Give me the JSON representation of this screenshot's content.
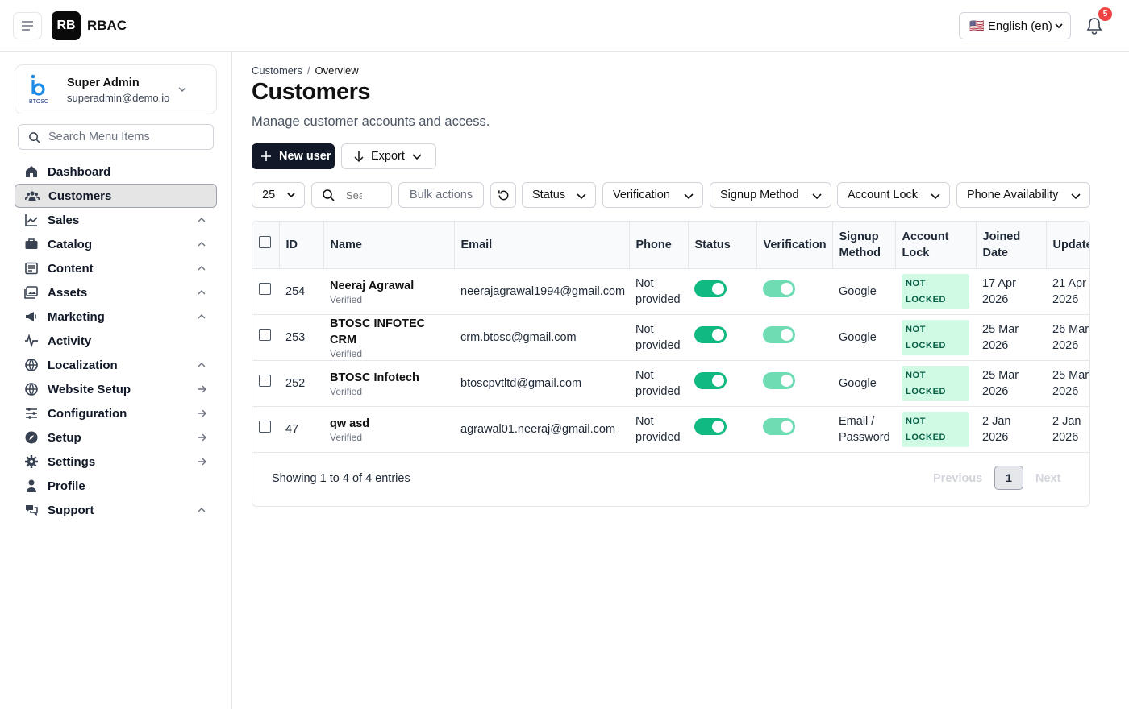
{
  "app": {
    "logo_text": "RB",
    "title": "RBAC"
  },
  "header": {
    "language": "🇺🇸 English (en)",
    "notification_count": "5"
  },
  "user": {
    "name": "Super Admin",
    "email": "superadmin@demo.io",
    "logo_text": "BTOSC"
  },
  "sidebar": {
    "search_placeholder": "Search Menu Items",
    "items": [
      {
        "label": "Dashboard",
        "icon": "home-icon",
        "trail": ""
      },
      {
        "label": "Customers",
        "icon": "users-icon",
        "trail": "",
        "active": true
      },
      {
        "label": "Sales",
        "icon": "chart-line-icon",
        "trail": "up"
      },
      {
        "label": "Catalog",
        "icon": "briefcase-icon",
        "trail": "up"
      },
      {
        "label": "Content",
        "icon": "newspaper-icon",
        "trail": "up"
      },
      {
        "label": "Assets",
        "icon": "images-icon",
        "trail": "up"
      },
      {
        "label": "Marketing",
        "icon": "megaphone-icon",
        "trail": "up"
      },
      {
        "label": "Activity",
        "icon": "activity-icon",
        "trail": ""
      },
      {
        "label": "Localization",
        "icon": "globe-icon",
        "trail": "up"
      },
      {
        "label": "Website Setup",
        "icon": "globe-icon",
        "trail": "arrow"
      },
      {
        "label": "Configuration",
        "icon": "sliders-icon",
        "trail": "arrow"
      },
      {
        "label": "Setup",
        "icon": "compass-icon",
        "trail": "arrow"
      },
      {
        "label": "Settings",
        "icon": "gear-icon",
        "trail": "arrow"
      },
      {
        "label": "Profile",
        "icon": "person-icon",
        "trail": ""
      },
      {
        "label": "Support",
        "icon": "chat-icon",
        "trail": "up"
      }
    ]
  },
  "page": {
    "breadcrumb": [
      "Customers",
      "Overview"
    ],
    "title": "Customers",
    "subtitle": "Manage customer accounts and access.",
    "new_user_label": "New user",
    "export_label": "Export"
  },
  "toolbar": {
    "per_page": "25",
    "search_placeholder": "Search",
    "bulk_actions": "Bulk actions",
    "filters": [
      "Status",
      "Verification",
      "Signup Method",
      "Account Lock",
      "Phone Availability"
    ]
  },
  "table": {
    "headers": [
      "ID",
      "Name",
      "Email",
      "Phone",
      "Status",
      "Verification",
      "Signup Method",
      "Account Lock",
      "Joined Date",
      "Updated"
    ],
    "rows": [
      {
        "id": "254",
        "name": "Neeraj Agrawal",
        "verified": "Verified",
        "email": "neerajagrawal1994@gmail.com",
        "phone": "Not provided",
        "status": true,
        "verification": true,
        "signup": "Google",
        "lock": "NOT LOCKED",
        "joined": "17 Apr 2026",
        "updated": "21 Apr 2026"
      },
      {
        "id": "253",
        "name": "BTOSC INFOTEC CRM",
        "verified": "Verified",
        "email": "crm.btosc@gmail.com",
        "phone": "Not provided",
        "status": true,
        "verification": true,
        "signup": "Google",
        "lock": "NOT LOCKED",
        "joined": "25 Mar 2026",
        "updated": "26 Mar 2026"
      },
      {
        "id": "252",
        "name": "BTOSC Infotech",
        "verified": "Verified",
        "email": "btoscpvtltd@gmail.com",
        "phone": "Not provided",
        "status": true,
        "verification": true,
        "signup": "Google",
        "lock": "NOT LOCKED",
        "joined": "25 Mar 2026",
        "updated": "25 Mar 2026"
      },
      {
        "id": "47",
        "name": "qw asd",
        "verified": "Verified",
        "email": "agrawal01.neeraj@gmail.com",
        "phone": "Not provided",
        "status": true,
        "verification": true,
        "signup": "Email / Password",
        "lock": "NOT LOCKED",
        "joined": "2 Jan 2026",
        "updated": "2 Jan 2026"
      }
    ],
    "showing": "Showing 1 to 4 of 4 entries",
    "prev": "Previous",
    "page": "1",
    "next": "Next"
  },
  "colors": {
    "accent_dark": "#111827",
    "toggle_on": "#10b981",
    "lock_bg": "#d1fae5",
    "badge": "#ef4444"
  }
}
